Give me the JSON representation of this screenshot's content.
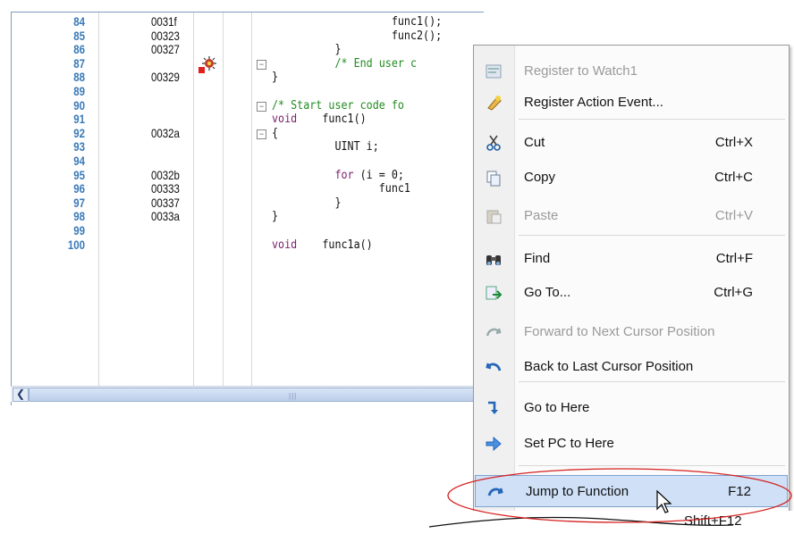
{
  "editor": {
    "rows": [
      {
        "line": "84",
        "addr": "0031f",
        "code": "                   func1();",
        "fold": ""
      },
      {
        "line": "85",
        "addr": "00323",
        "code": "                   func2();",
        "fold": ""
      },
      {
        "line": "86",
        "addr": "00327",
        "code": "          }",
        "fold": ""
      },
      {
        "line": "87",
        "addr": "",
        "code": "          /* End user c",
        "fold": "−",
        "type": "comment"
      },
      {
        "line": "88",
        "addr": "00329",
        "code": "}",
        "fold": ""
      },
      {
        "line": "89",
        "addr": "",
        "code": "",
        "fold": ""
      },
      {
        "line": "90",
        "addr": "",
        "code": "/* Start user code fo",
        "fold": "−",
        "type": "comment"
      },
      {
        "line": "91",
        "addr": "",
        "code": "void    func1()",
        "fold": "",
        "type": "void"
      },
      {
        "line": "92",
        "addr": "0032a",
        "code": "{",
        "fold": "−"
      },
      {
        "line": "93",
        "addr": "",
        "code": "          UINT i;",
        "fold": ""
      },
      {
        "line": "94",
        "addr": "",
        "code": "",
        "fold": ""
      },
      {
        "line": "95",
        "addr": "0032b",
        "code": "          for (i = 0;",
        "fold": "",
        "type": "for"
      },
      {
        "line": "96",
        "addr": "00333",
        "code": "                 func1",
        "fold": ""
      },
      {
        "line": "97",
        "addr": "00337",
        "code": "          }",
        "fold": ""
      },
      {
        "line": "98",
        "addr": "0033a",
        "code": "}",
        "fold": ""
      },
      {
        "line": "99",
        "addr": "",
        "code": "",
        "fold": ""
      },
      {
        "line": "100",
        "addr": "",
        "code": "void    func1a()",
        "fold": "",
        "type": "void"
      }
    ]
  },
  "menu": {
    "items": [
      {
        "label": "Register to Watch1",
        "shortcut": "",
        "disabled": true,
        "icon": "watch-icon"
      },
      {
        "label": "Register Action Event...",
        "shortcut": "",
        "disabled": false,
        "icon": "action-event-icon"
      },
      {
        "label": "Cut",
        "shortcut": "Ctrl+X",
        "disabled": false,
        "icon": "scissors-icon"
      },
      {
        "label": "Copy",
        "shortcut": "Ctrl+C",
        "disabled": false,
        "icon": "copy-icon"
      },
      {
        "label": "Paste",
        "shortcut": "Ctrl+V",
        "disabled": true,
        "icon": "paste-icon"
      },
      {
        "label": "Find",
        "shortcut": "Ctrl+F",
        "disabled": false,
        "icon": "binoculars-icon"
      },
      {
        "label": "Go To...",
        "shortcut": "Ctrl+G",
        "disabled": false,
        "icon": "goto-icon"
      },
      {
        "label": "Forward to Next Cursor Position",
        "shortcut": "",
        "disabled": true,
        "icon": "forward-arrow-icon"
      },
      {
        "label": "Back to Last Cursor Position",
        "shortcut": "",
        "disabled": false,
        "icon": "back-arrow-icon"
      },
      {
        "label": "Go to Here",
        "shortcut": "",
        "disabled": false,
        "icon": "go-here-icon"
      },
      {
        "label": "Set PC to Here",
        "shortcut": "",
        "disabled": false,
        "icon": "set-pc-icon"
      },
      {
        "label": "Jump to Function",
        "shortcut": "F12",
        "disabled": false,
        "icon": "jump-function-icon"
      },
      {
        "label": "",
        "shortcut": "Shift+F12",
        "disabled": false,
        "icon": ""
      }
    ]
  },
  "colors": {
    "line_number": "#3a7ab8",
    "keyword": "#7a1f6b",
    "comment": "#228b22",
    "highlight": "#cfe0f7",
    "callout": "#d62020"
  }
}
